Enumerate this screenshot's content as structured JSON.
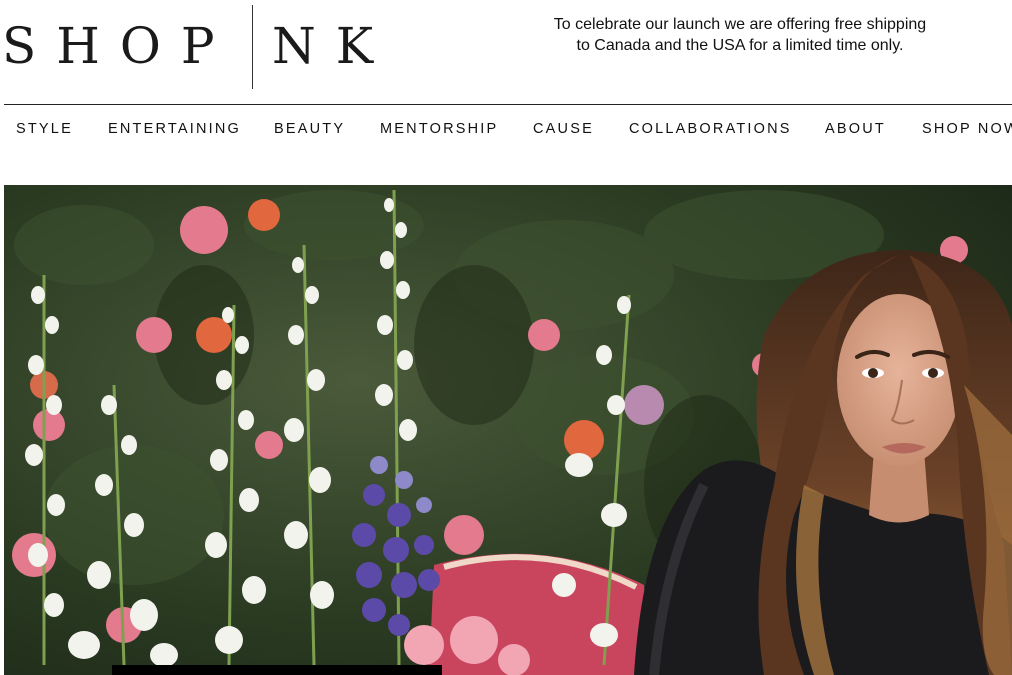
{
  "brand": {
    "logo_left": "SHOP",
    "logo_right": "NK"
  },
  "promo": {
    "line1": "To celebrate our launch we are offering free shipping",
    "line2": "to Canada and the USA for a limited time only."
  },
  "nav": {
    "items": [
      {
        "label": "STYLE"
      },
      {
        "label": "ENTERTAINING"
      },
      {
        "label": "BEAUTY"
      },
      {
        "label": "MENTORSHIP"
      },
      {
        "label": "CAUSE"
      },
      {
        "label": "COLLABORATIONS"
      },
      {
        "label": "ABOUT"
      },
      {
        "label": "SHOP NOW"
      }
    ]
  },
  "hero": {
    "image_subject": "woman-with-long-brown-hair-in-front-of-flower-wall",
    "palette": {
      "foliage": "#2b3b22",
      "pink": "#e37a8e",
      "white_flower": "#f3f3ee",
      "purple": "#5b4aa8",
      "hair": "#6b4228",
      "skin": "#d9a58a",
      "shirt": "#1b1b1d"
    }
  }
}
